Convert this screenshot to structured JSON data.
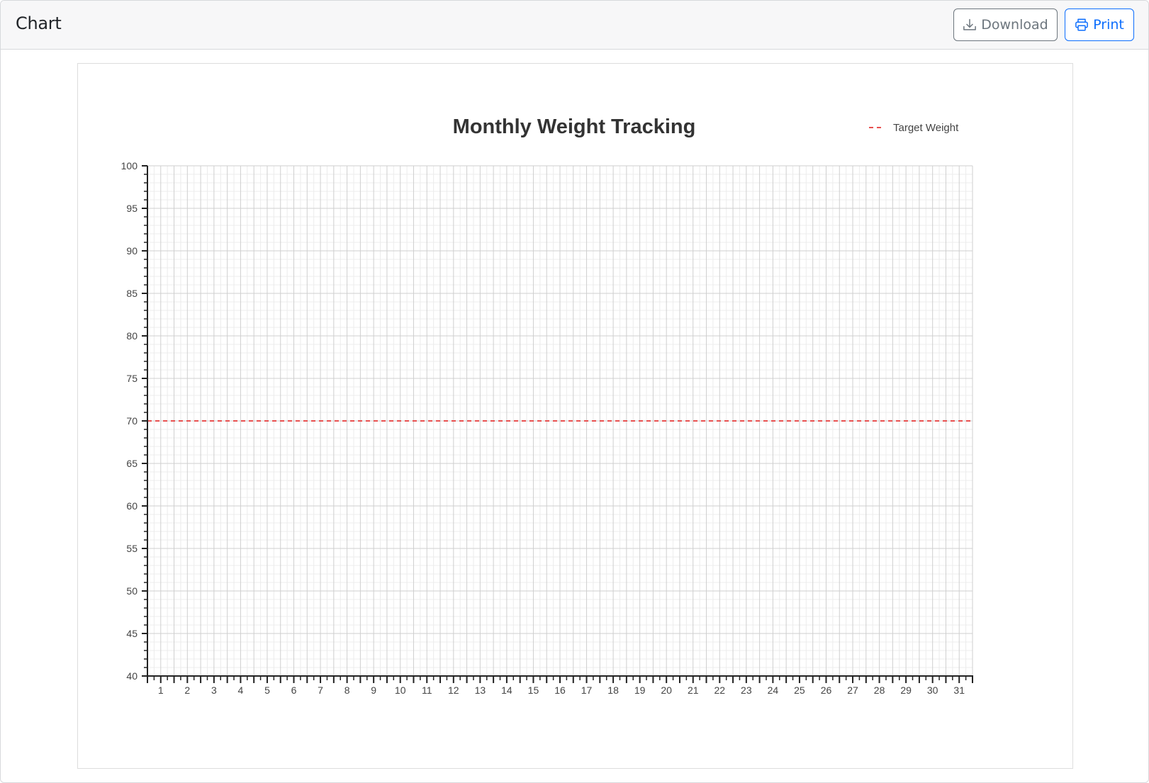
{
  "header": {
    "title": "Chart",
    "download_label": "Download",
    "print_label": "Print",
    "download_icon": "download-icon",
    "print_icon": "printer-icon"
  },
  "colors": {
    "primary": "#0d6efd",
    "secondary": "#6c757d",
    "target_line": "#e8504f"
  },
  "chart_data": {
    "type": "line",
    "title": "Monthly Weight Tracking",
    "xlabel": "",
    "ylabel": "",
    "x_ticks": [
      1,
      2,
      3,
      4,
      5,
      6,
      7,
      8,
      9,
      10,
      11,
      12,
      13,
      14,
      15,
      16,
      17,
      18,
      19,
      20,
      21,
      22,
      23,
      24,
      25,
      26,
      27,
      28,
      29,
      30,
      31
    ],
    "y_ticks": [
      40,
      45,
      50,
      55,
      60,
      65,
      70,
      75,
      80,
      85,
      90,
      95,
      100
    ],
    "xlim": [
      0.5,
      31.5
    ],
    "ylim": [
      40,
      100
    ],
    "grid": true,
    "legend": "top-right",
    "series": [
      {
        "name": "Target Weight",
        "style": "dashed",
        "color": "#e8504f",
        "x": [
          0.5,
          31.5
        ],
        "y": [
          70,
          70
        ]
      }
    ]
  }
}
